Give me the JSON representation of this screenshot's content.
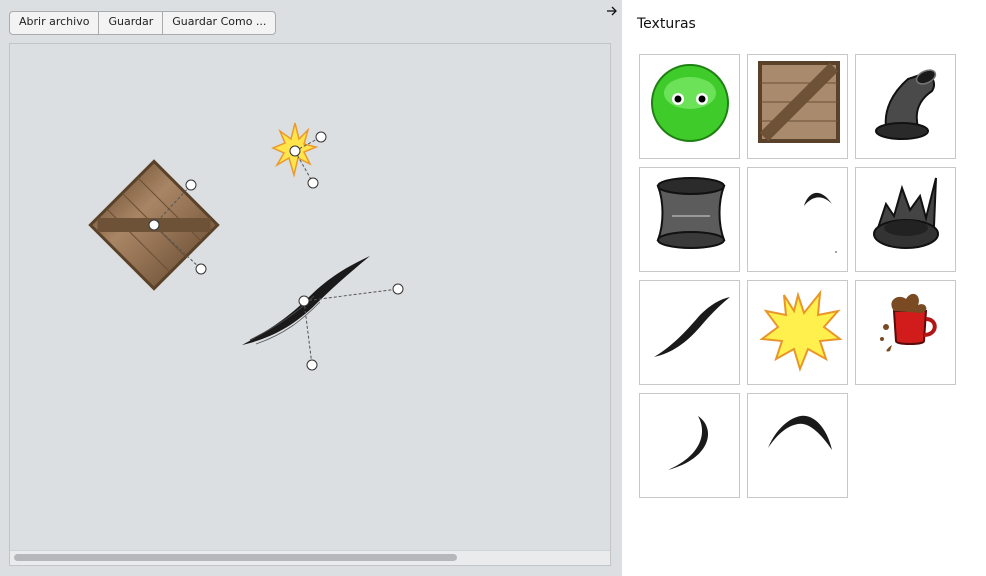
{
  "toolbar": {
    "open_label": "Abrir archivo",
    "save_label": "Guardar",
    "save_as_label": "Guardar Como ..."
  },
  "panel": {
    "collapse_icon": "arrow-right-icon",
    "title": "Texturas"
  },
  "canvas_objects": [
    {
      "name": "crate",
      "texture": "wooden-crate"
    },
    {
      "name": "spark",
      "texture": "yellow-burst"
    },
    {
      "name": "brush-stroke",
      "texture": "ink-slash"
    }
  ],
  "textures": [
    {
      "name": "green-face"
    },
    {
      "name": "wooden-crate"
    },
    {
      "name": "bent-pipe"
    },
    {
      "name": "pipe-barrel"
    },
    {
      "name": "small-arc"
    },
    {
      "name": "broken-pipe"
    },
    {
      "name": "ink-slash"
    },
    {
      "name": "yellow-burst"
    },
    {
      "name": "coffee-mug"
    },
    {
      "name": "crescent-stroke"
    },
    {
      "name": "arch-stroke"
    }
  ],
  "colors": {
    "background": "#dcdfe1",
    "panel": "#ffffff",
    "tile_border": "#c8c8c8"
  }
}
